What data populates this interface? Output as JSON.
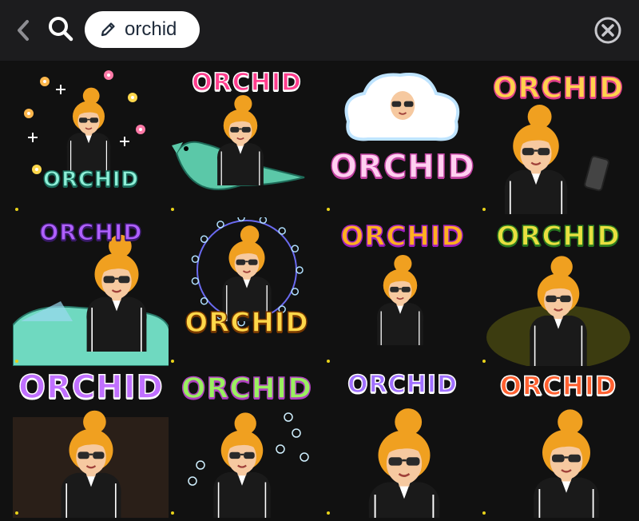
{
  "header": {
    "back_icon": "chevron-left-icon",
    "search_icon": "search-icon",
    "search_chip": {
      "icon": "pencil-icon",
      "label": "orchid"
    },
    "clear_icon": "close-circle-icon"
  },
  "stickers": [
    {
      "caption": "ORCHID",
      "scene": "fireworks-flowers",
      "fill": "#8ef0d8",
      "stroke": "#1a6a5a"
    },
    {
      "caption": "ORCHID",
      "scene": "riding-dinosaur",
      "fill": "#ff3d8d",
      "stroke": "#ffffff"
    },
    {
      "caption": "ORCHID",
      "scene": "cloud-head",
      "fill": "#ffd0f0",
      "stroke": "#c040a0"
    },
    {
      "caption": "ORCHID",
      "scene": "holding-phone",
      "fill": "#ffd24d",
      "stroke": "#e0408a"
    },
    {
      "caption": "ORCHID",
      "scene": "driving-car",
      "fill": "#b060ff",
      "stroke": "#3a1a6a"
    },
    {
      "caption": "ORCHID",
      "scene": "bubble-circle",
      "fill": "#ffd84a",
      "stroke": "#7a3a00"
    },
    {
      "caption": "ORCHID",
      "scene": "kneeling-crying",
      "fill": "#ffb020",
      "stroke": "#a020c0"
    },
    {
      "caption": "ORCHID",
      "scene": "spotlight",
      "fill": "#e8e040",
      "stroke": "#2a7a20"
    },
    {
      "caption": "ORCHID",
      "scene": "arms-up-cheering",
      "fill": "#c070ff",
      "stroke": "#ffffff"
    },
    {
      "caption": "ORCHID",
      "scene": "snorkeling",
      "fill": "#9af060",
      "stroke": "#b040c0"
    },
    {
      "caption": "ORCHID",
      "scene": "surprised-face",
      "fill": "#a070ff",
      "stroke": "#ffffff"
    },
    {
      "caption": "ORCHID",
      "scene": "nail-biting",
      "fill": "#ff6030",
      "stroke": "#ffffff"
    }
  ],
  "colors": {
    "topbar": "#1c1c1e",
    "background": "#111111",
    "hair": "#f0a020",
    "skin": "#f6c9a0",
    "outfit": "#1a1a1a",
    "indicator_dot": "#e8d21a"
  }
}
